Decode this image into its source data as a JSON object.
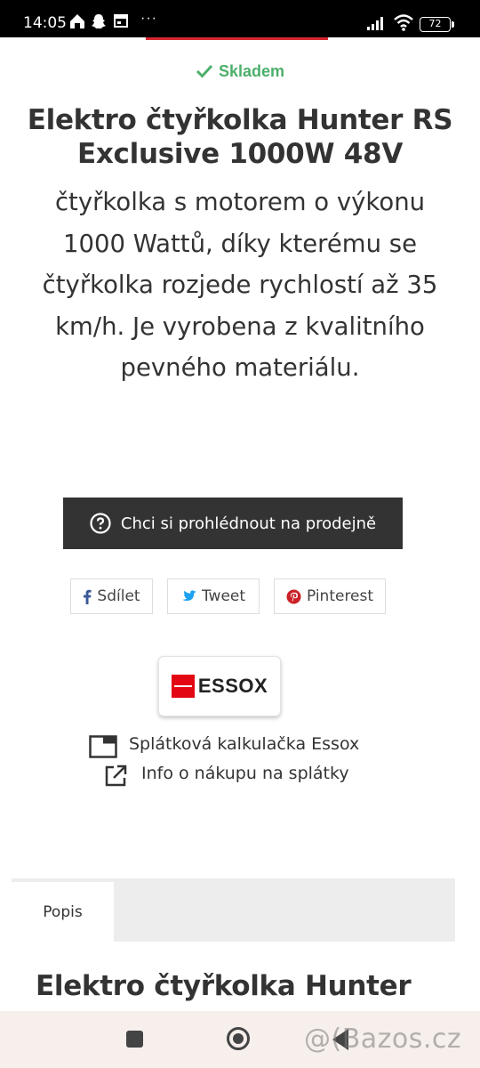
{
  "status_bar": {
    "time": "14:05",
    "more": "···",
    "battery": "72"
  },
  "stock": {
    "label": "Skladem"
  },
  "product": {
    "title_line1": "Elektro čtyřkolka Hunter RS",
    "title_line2": "Exclusive 1000W 48V",
    "desc_lines": [
      "čtyřkolka s motorem o výkonu",
      "1000 Wattů, díky kterému se",
      "čtyřkolka rozjede rychlostí až 35",
      "km/h. Je vyrobena z kvalitního",
      "pevného materiálu."
    ]
  },
  "view_button": {
    "label": "Chci si prohlédnout na prodejně"
  },
  "share": {
    "facebook": "Sdílet",
    "twitter": "Tweet",
    "pinterest": "Pinterest"
  },
  "essox": {
    "logo_text": "ESSOX",
    "calculator_link": "Splátková kalkulačka Essox",
    "info_link": "Info o nákupu na splátky"
  },
  "tabs": {
    "active": "Popis"
  },
  "section": {
    "title": "Elektro čtyřkolka Hunter"
  },
  "watermark": "@(Bazos.cz",
  "colors": {
    "accent_green": "#4caf6a",
    "button_dark": "#333333",
    "brand_red": "#e30613",
    "facebook_blue": "#3b5998",
    "twitter_blue": "#1da1f2",
    "pinterest_red": "#cb2027"
  }
}
